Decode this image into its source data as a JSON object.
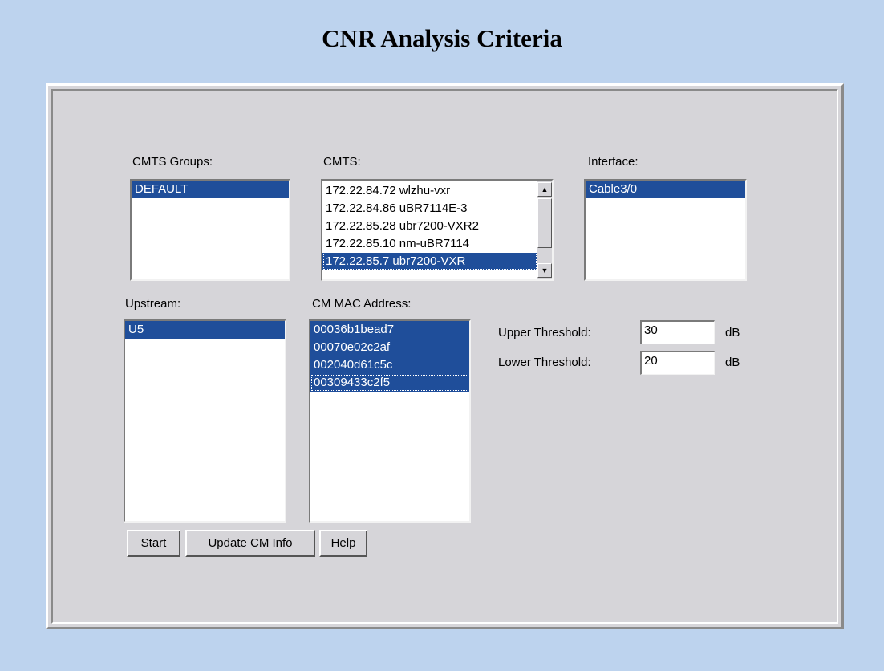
{
  "title": "CNR Analysis Criteria",
  "cmts_groups": {
    "label": "CMTS Groups:",
    "items": [
      "DEFAULT"
    ]
  },
  "cmts": {
    "label": "CMTS:",
    "items": [
      "172.22.84.72 wlzhu-vxr",
      "172.22.84.86 uBR7114E-3",
      "172.22.85.28 ubr7200-VXR2",
      "172.22.85.10 nm-uBR7114",
      "172.22.85.7 ubr7200-VXR"
    ],
    "scroll_up_icon": "arrow-up",
    "scroll_down_icon": "arrow-down"
  },
  "interface": {
    "label": "Interface:",
    "items": [
      "Cable3/0"
    ]
  },
  "upstream": {
    "label": "Upstream:",
    "items": [
      "U5"
    ]
  },
  "cm_mac": {
    "label": "CM MAC Address:",
    "items": [
      "00036b1bead7",
      "00070e02c2af",
      "002040d61c5c",
      "00309433c2f5"
    ]
  },
  "thresholds": {
    "upper_label": "Upper Threshold:",
    "upper_value": "30",
    "upper_unit": "dB",
    "lower_label": "Lower Threshold:",
    "lower_value": "20",
    "lower_unit": "dB"
  },
  "buttons": {
    "start": "Start",
    "update": "Update CM Info",
    "help": "Help"
  },
  "colors": {
    "background": "#bdd3ee",
    "panel": "#d6d5d9",
    "selection": "#1f4e9a"
  }
}
